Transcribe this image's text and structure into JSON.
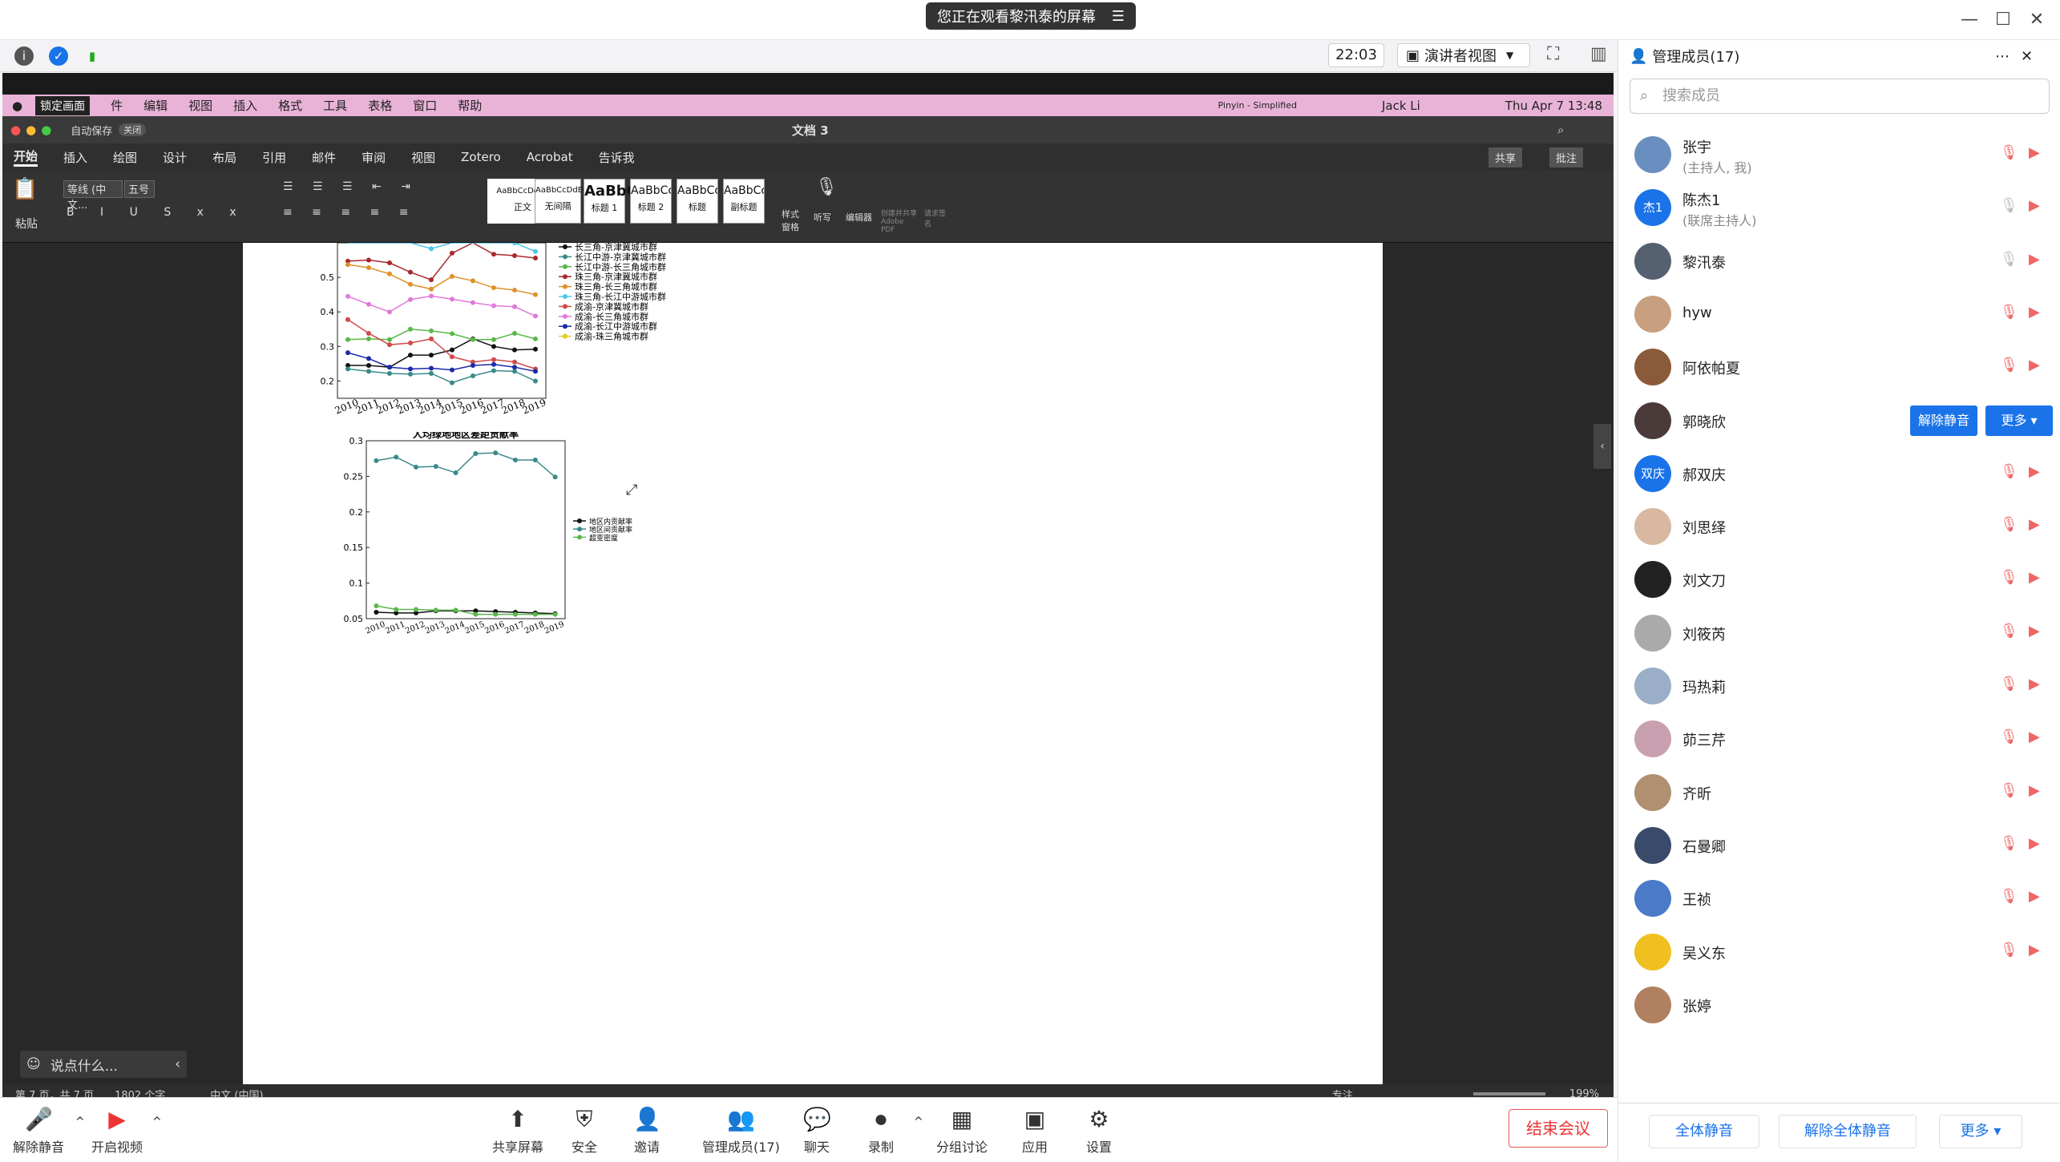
{
  "window": {
    "banner": "您正在观看黎汛泰的屏幕"
  },
  "toolbar": {
    "time": "22:03",
    "view_label": "演讲者视图"
  },
  "lock_badge": "锁定画面",
  "mac_menu": {
    "items": [
      "件",
      "编辑",
      "视图",
      "插入",
      "格式",
      "工具",
      "表格",
      "窗口",
      "帮助"
    ],
    "right": [
      "Pinyin - Simplified",
      "Jack Li",
      "Thu Apr 7  13:48"
    ]
  },
  "word": {
    "autosave": "自动保存",
    "autosave_state": "关闭",
    "doc_title": "文档 3",
    "tabs": [
      "开始",
      "插入",
      "绘图",
      "设计",
      "布局",
      "引用",
      "邮件",
      "审阅",
      "视图",
      "Zotero",
      "Acrobat",
      "告诉我"
    ],
    "share": "共享",
    "comments": "批注",
    "paste": "粘贴",
    "font_name": "等线 (中文...",
    "font_size": "五号",
    "styles": [
      {
        "preview": "AaBbCcDdEe",
        "name": "正文"
      },
      {
        "preview": "AaBbCcDdEe",
        "name": "无间隔"
      },
      {
        "preview": "AaBbC",
        "name": "标题 1"
      },
      {
        "preview": "AaBbCcI",
        "name": "标题 2"
      },
      {
        "preview": "AaBbCcI",
        "name": "标题"
      },
      {
        "preview": "AaBbCcI",
        "name": "副标题"
      }
    ],
    "ribbon_right": [
      "样式窗格",
      "听写",
      "编辑器",
      "创建并共享 Adobe PDF",
      "请求签名"
    ],
    "status": {
      "page": "第 7 页，共 7 页",
      "words": "1802 个字",
      "lang": "中文 (中国)",
      "focus": "专注",
      "zoom": "199%"
    }
  },
  "chart_data": [
    {
      "type": "line",
      "title": "",
      "x": [
        "2010",
        "2011",
        "2012",
        "2013",
        "2014",
        "2015",
        "2016",
        "2017",
        "2018",
        "2019"
      ],
      "ylim": [
        0.15,
        0.6
      ],
      "yticks": [
        "0.2",
        "0.3",
        "0.4",
        "0.5"
      ],
      "legend": "right",
      "series": [
        {
          "name": "长三角-京津冀城市群",
          "color": "#111111",
          "values": [
            0.245,
            0.245,
            0.24,
            0.275,
            0.275,
            0.29,
            0.322,
            0.3,
            0.29,
            0.292
          ]
        },
        {
          "name": "长江中游-京津冀城市群",
          "color": "#3a8a8a",
          "values": [
            0.235,
            0.228,
            0.222,
            0.22,
            0.222,
            0.195,
            0.215,
            0.23,
            0.228,
            0.2
          ]
        },
        {
          "name": "长江中游-长三角城市群",
          "color": "#5ab84a",
          "values": [
            0.32,
            0.322,
            0.32,
            0.35,
            0.345,
            0.337,
            0.32,
            0.32,
            0.338,
            0.322
          ]
        },
        {
          "name": "珠三角-京津冀城市群",
          "color": "#a8282c",
          "values": [
            0.547,
            0.55,
            0.542,
            0.515,
            0.493,
            0.57,
            0.615,
            0.567,
            0.563,
            0.556
          ]
        },
        {
          "name": "珠三角-长三角城市群",
          "color": "#e0902a",
          "values": [
            0.537,
            0.528,
            0.51,
            0.48,
            0.466,
            0.503,
            0.49,
            0.47,
            0.463,
            0.45
          ]
        },
        {
          "name": "珠三角-长江中游城市群",
          "color": "#4cc8e8",
          "values": [
            0.63,
            0.62,
            0.615,
            0.61,
            0.583,
            0.63,
            0.62,
            0.61,
            0.6,
            0.575
          ]
        },
        {
          "name": "成渝-京津冀城市群",
          "color": "#d04a4a",
          "values": [
            0.378,
            0.338,
            0.305,
            0.31,
            0.322,
            0.27,
            0.255,
            0.262,
            0.255,
            0.235
          ]
        },
        {
          "name": "成渝-长三角城市群",
          "color": "#e07adc",
          "values": [
            0.445,
            0.422,
            0.4,
            0.436,
            0.446,
            0.437,
            0.427,
            0.418,
            0.415,
            0.388
          ]
        },
        {
          "name": "成渝-长江中游城市群",
          "color": "#1a2aa8",
          "values": [
            0.282,
            0.265,
            0.24,
            0.235,
            0.237,
            0.232,
            0.245,
            0.248,
            0.24,
            0.228
          ]
        },
        {
          "name": "成渝-珠三角城市群",
          "color": "#e0d020",
          "values": []
        }
      ]
    },
    {
      "type": "line",
      "title": "人均绿地地区差距贡献率",
      "x": [
        "2010",
        "2011",
        "2012",
        "2013",
        "2014",
        "2015",
        "2016",
        "2017",
        "2018",
        "2019"
      ],
      "ylim": [
        0.05,
        0.3
      ],
      "yticks": [
        "0.05",
        "0.1",
        "0.15",
        "0.2",
        "0.25",
        "0.3"
      ],
      "legend": "right",
      "series": [
        {
          "name": "地区内贡献率",
          "color": "#111111",
          "values": [
            0.059,
            0.058,
            0.058,
            0.061,
            0.061,
            0.061,
            0.06,
            0.059,
            0.058,
            0.057
          ]
        },
        {
          "name": "地区间贡献率",
          "color": "#3a8a8a",
          "values": [
            0.272,
            0.277,
            0.263,
            0.264,
            0.255,
            0.282,
            0.283,
            0.273,
            0.273,
            0.249
          ]
        },
        {
          "name": "超变密度",
          "color": "#5ab84a",
          "values": [
            0.068,
            0.063,
            0.063,
            0.062,
            0.062,
            0.056,
            0.056,
            0.056,
            0.056,
            0.056
          ]
        }
      ]
    }
  ],
  "chat_placeholder": "说点什么...",
  "bottombar": {
    "left": [
      "解除静音",
      "开启视频"
    ],
    "center": [
      "共享屏幕",
      "安全",
      "邀请",
      "管理成员(17)",
      "聊天",
      "录制",
      "分组讨论",
      "应用",
      "设置"
    ],
    "end": "结束会议"
  },
  "side": {
    "title": "管理成员(17)",
    "search_placeholder": "搜索成员",
    "members": [
      {
        "name": "张宇",
        "sub": "(主持人, 我)",
        "avatar": "",
        "color": "#6a8ec0"
      },
      {
        "name": "陈杰1",
        "sub": "(联席主持人)",
        "avatar": "杰1",
        "color": "#1a73e8"
      },
      {
        "name": "黎汛泰",
        "sub": "",
        "avatar": "",
        "color": "#556070"
      },
      {
        "name": "hyw",
        "sub": "",
        "avatar": "",
        "color": "#c8a080"
      },
      {
        "name": "阿依帕夏",
        "sub": "",
        "avatar": "",
        "color": "#8a5a3a"
      },
      {
        "name": "郭晓欣",
        "sub": "",
        "avatar": "",
        "color": "#4a3a3a"
      },
      {
        "name": "郝双庆",
        "sub": "",
        "avatar": "双庆",
        "color": "#1a73e8"
      },
      {
        "name": "刘思绎",
        "sub": "",
        "avatar": "",
        "color": "#d8b8a0"
      },
      {
        "name": "刘文刀",
        "sub": "",
        "avatar": "",
        "color": "#222222"
      },
      {
        "name": "刘筱芮",
        "sub": "",
        "avatar": "",
        "color": "#aaaaaa"
      },
      {
        "name": "玛热莉",
        "sub": "",
        "avatar": "",
        "color": "#9aaec8"
      },
      {
        "name": "茆三芹",
        "sub": "",
        "avatar": "",
        "color": "#c8a0b0"
      },
      {
        "name": "齐昕",
        "sub": "",
        "avatar": "",
        "color": "#b09070"
      },
      {
        "name": "石曼卿",
        "sub": "",
        "avatar": "",
        "color": "#3a4a6a"
      },
      {
        "name": "王祯",
        "sub": "",
        "avatar": "",
        "color": "#4a7ac8"
      },
      {
        "name": "吴义东",
        "sub": "",
        "avatar": "",
        "color": "#f0c020"
      },
      {
        "name": "张婷",
        "sub": "",
        "avatar": "",
        "color": "#b08060"
      }
    ],
    "unmute_btn": "解除静音",
    "more_btn": "更多 ▾",
    "footer": [
      "全体静音",
      "解除全体静音",
      "更多 ▾"
    ]
  }
}
